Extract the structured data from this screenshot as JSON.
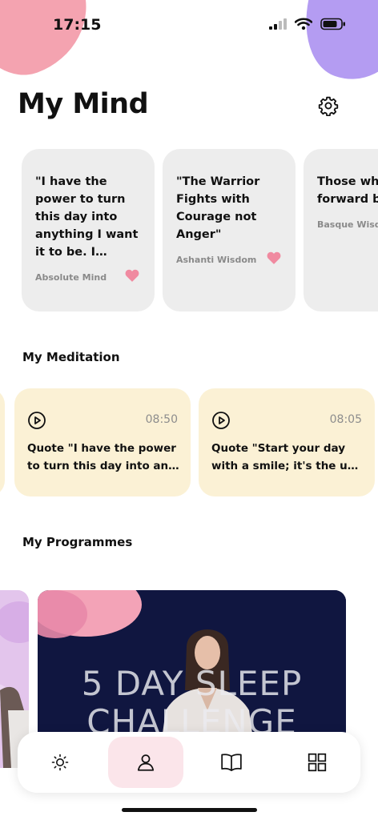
{
  "status_bar": {
    "time": "17:15"
  },
  "header": {
    "title": "My Mind",
    "settings_icon": "gear-icon"
  },
  "quotes": [
    {
      "text": "\"I have the power to turn this day into anything I want it to be. I choose to make it great.\"",
      "source": "Absolute Mind",
      "liked": true
    },
    {
      "text": "\"The Warrior Fights with Courage not Anger\"",
      "source": "Ashanti Wisdom",
      "liked": true
    },
    {
      "text": "Those who look forward behind.",
      "source": "Basque Wisdom",
      "liked": false
    }
  ],
  "meditation": {
    "title": "My Meditation",
    "items": [
      {
        "duration": "08:50",
        "line1": "Quote \"I have the power",
        "line2": "to turn this day into anything I want it to be\""
      },
      {
        "duration": "08:05",
        "line1": "Quote \"Start your day",
        "line2": "with a smile; it's the universe's gift\""
      }
    ]
  },
  "programmes": {
    "title": "My Programmes",
    "featured": {
      "line1": "5 DAY SLEEP",
      "line2": "CHALLENGE"
    }
  },
  "nav": [
    {
      "icon": "sun-icon",
      "active": false
    },
    {
      "icon": "profile-icon",
      "active": true
    },
    {
      "icon": "book-icon",
      "active": false
    },
    {
      "icon": "grid-icon",
      "active": false
    }
  ],
  "colors": {
    "heart": "#f08aa0",
    "meditation_card": "#fbf1d5",
    "quote_card": "#ededed",
    "nav_active": "#fbe5ea",
    "programme_bg": "#101640"
  }
}
